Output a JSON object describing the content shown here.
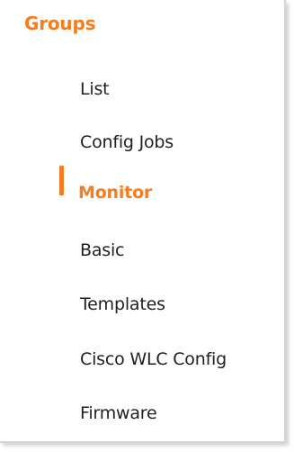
{
  "section": {
    "title": "Groups"
  },
  "menu": {
    "items": [
      {
        "label": "List"
      },
      {
        "label": "Config Jobs"
      },
      {
        "label": "Monitor"
      },
      {
        "label": "Basic"
      },
      {
        "label": "Templates"
      },
      {
        "label": "Cisco WLC Config"
      },
      {
        "label": "Firmware"
      }
    ],
    "active_item": "Monitor"
  },
  "colors": {
    "accent": "#f57d20",
    "text": "#1f1f1f",
    "background": "#ffffff"
  }
}
